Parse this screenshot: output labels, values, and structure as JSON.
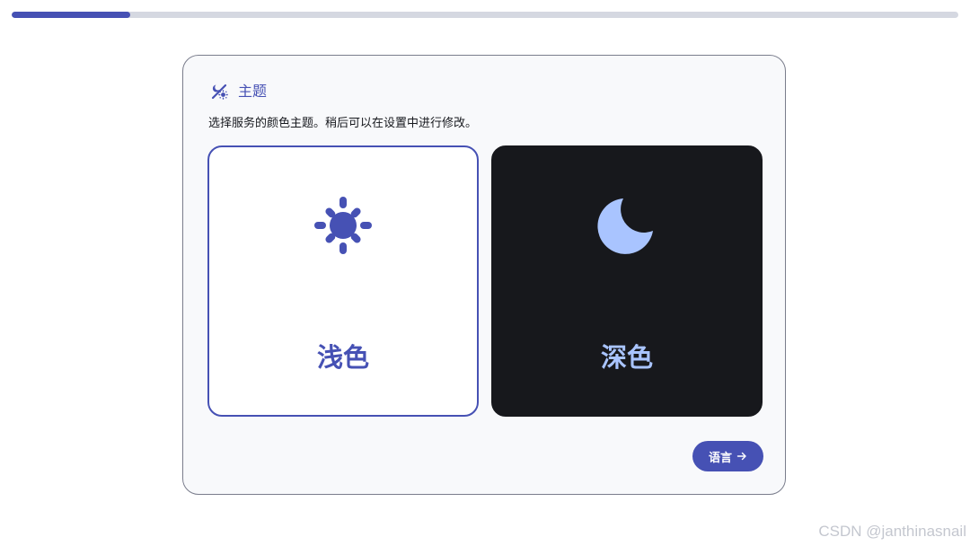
{
  "progress": {
    "fraction": 0.125,
    "fill_color": "#4651b4",
    "track_color": "#d5d8e1"
  },
  "header": {
    "icon": "theme-icon",
    "title": "主题"
  },
  "description": "选择服务的颜色主题。稍后可以在设置中进行修改。",
  "options": {
    "light": {
      "label": "浅色",
      "icon": "sun-icon",
      "selected": true,
      "background": "#ffffff",
      "accent": "#4651b4"
    },
    "dark": {
      "label": "深色",
      "icon": "moon-icon",
      "selected": false,
      "background": "#17181c",
      "accent": "#a9c4ff"
    }
  },
  "next_button": {
    "label": "语言",
    "icon": "arrow-right-icon"
  },
  "watermark": "CSDN @janthinasnail"
}
